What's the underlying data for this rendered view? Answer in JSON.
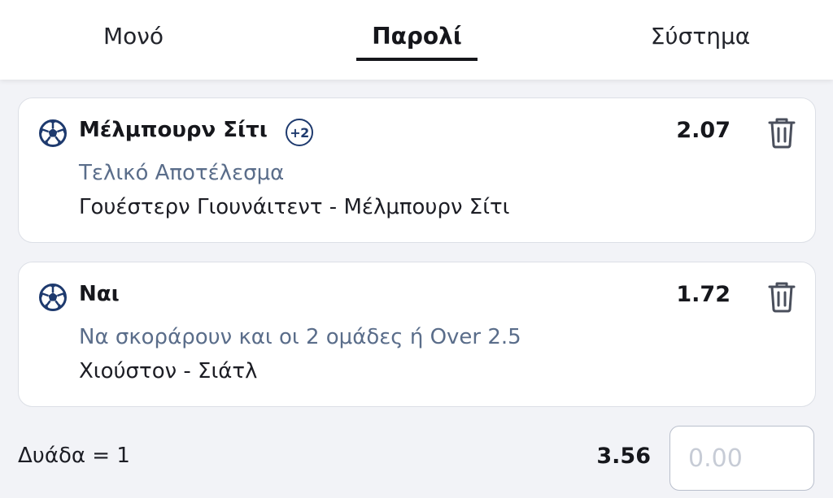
{
  "tabs": [
    {
      "label": "Μονό",
      "active": false
    },
    {
      "label": "Παρολί",
      "active": true
    },
    {
      "label": "Σύστημα",
      "active": false
    }
  ],
  "bets": [
    {
      "icon": "soccer-ball-icon",
      "selection": "Μέλμπουρν Σίτι",
      "badge": "+2",
      "odds": "2.07",
      "market": "Τελικό Αποτέλεσμα",
      "event": "Γουέστερν Γιουνάιτεντ - Μέλμπουρν Σίτι"
    },
    {
      "icon": "soccer-ball-icon",
      "selection": "Ναι",
      "odds": "1.72",
      "market": "Να σκοράρουν και οι 2 ομάδες ή Over 2.5",
      "event": "Χιούστον - Σιάτλ"
    }
  ],
  "footer": {
    "label": "Δυάδα = 1",
    "total_odds": "3.56",
    "stake_placeholder": "0.00"
  },
  "colors": {
    "brand_navy": "#1e3a6e",
    "market_text": "#5a6d8a",
    "background": "#f2f3f7"
  }
}
